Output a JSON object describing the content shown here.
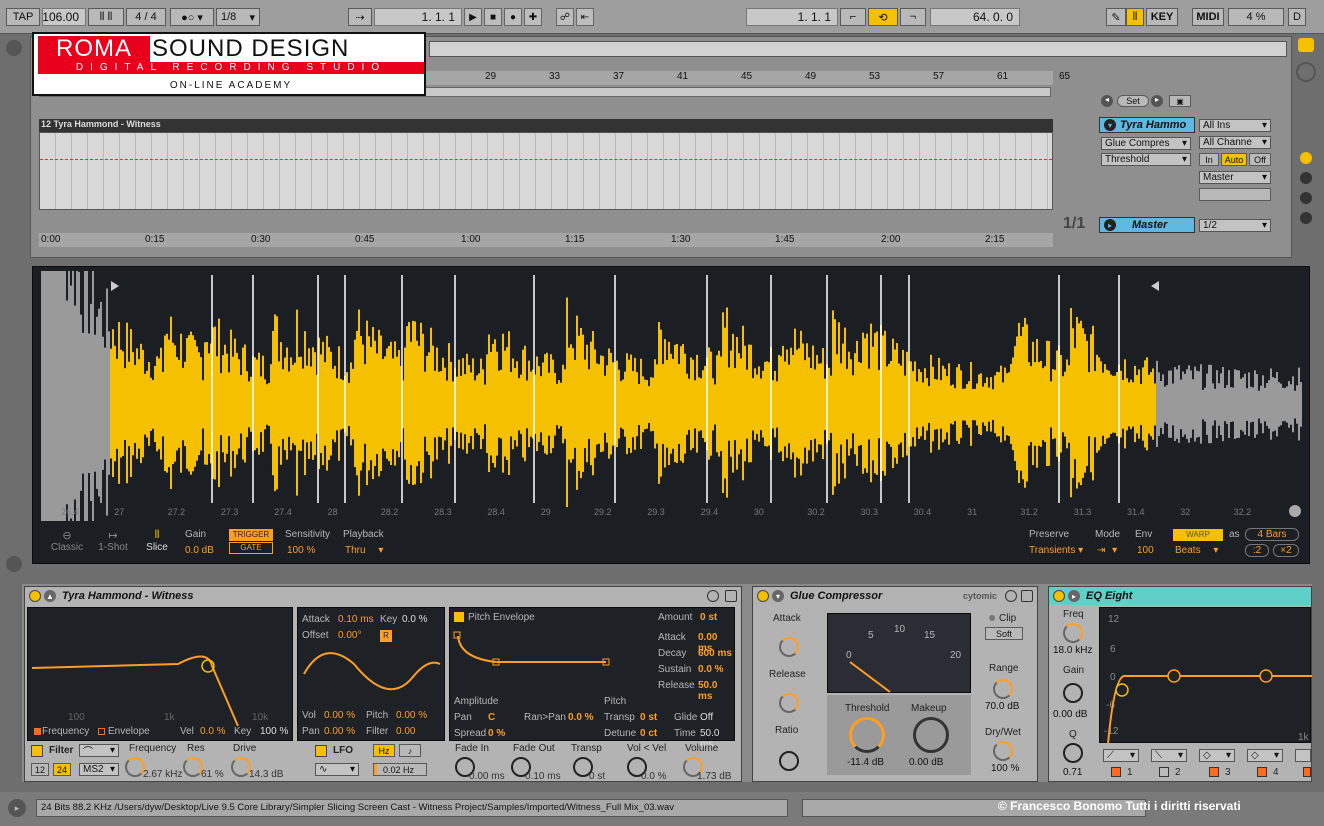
{
  "transport": {
    "tap": "TAP",
    "tempo": "106.00",
    "sig_num": "4",
    "sig_den": "4",
    "quant": "1/8",
    "pos1": "1.   1.   1",
    "pos2": "1.   1.   1",
    "loop_len": "64.   0.   0",
    "key": "KEY",
    "midi": "MIDI",
    "cpu": "4 %",
    "d": "D"
  },
  "logo": {
    "line1a": "ROMA",
    "line1b": "SOUND DESIGN",
    "line2": "DIGITAL RECORDING STUDIO",
    "line3": "ON-LINE ACADEMY"
  },
  "arrangement": {
    "bar_ticks": [
      "29",
      "33",
      "37",
      "41",
      "45",
      "49",
      "53",
      "57",
      "61",
      "65"
    ],
    "track_name": "12 Tyra Hammond - Witness",
    "time_ticks": [
      "0:00",
      "0:15",
      "0:30",
      "0:45",
      "1:00",
      "1:15",
      "1:30",
      "1:45",
      "2:00",
      "2:15"
    ],
    "set_label": "Set",
    "page": "1/1",
    "track_title": "Tyra Hammo",
    "device": "Glue Compres",
    "param": "Threshold",
    "input": "All Ins",
    "channel": "All Channe",
    "mon_in": "In",
    "mon_auto": "Auto",
    "mon_off": "Off",
    "output": "Master",
    "master_label": "Master",
    "master_out": "1/2"
  },
  "sample": {
    "beat_ticks": [
      "26.4",
      "27",
      "27.2",
      "27.3",
      "27.4",
      "28",
      "28.2",
      "28.3",
      "28.4",
      "29",
      "29.2",
      "29.3",
      "29.4",
      "30",
      "30.2",
      "30.3",
      "30.4",
      "31",
      "31.2",
      "31.3",
      "31.4",
      "32",
      "32.2"
    ],
    "modes": [
      "Classic",
      "1-Shot",
      "Slice"
    ],
    "gain_label": "Gain",
    "gain": "0.0 dB",
    "trigger": "TRIGGER",
    "gate": "GATE",
    "sensitivity_label": "Sensitivity",
    "sensitivity": "100 %",
    "playback_label": "Playback",
    "playback": "Thru",
    "preserve_label": "Preserve",
    "preserve": "Transients",
    "mode_label": "Mode",
    "mode": "⇥",
    "env_label": "Env",
    "env": "100",
    "warp": "WARP",
    "as": "as",
    "bars": "4 Bars",
    "half": ":2",
    "double": "×2",
    "beats": "Beats"
  },
  "simpler": {
    "title": "Tyra Hammond - Witness",
    "axis": [
      "100",
      "1k",
      "10k"
    ],
    "legend_freq": "Frequency",
    "legend_env": "Envelope",
    "vel_label": "Vel",
    "vel": "0.0 %",
    "key_label": "Key",
    "key": "100 %",
    "filter": "Filter",
    "f12": "12",
    "f24": "24",
    "ms2": "MS2",
    "freq_label": "Frequency",
    "freq": "2.67 kHz",
    "res_label": "Res",
    "res": "61 %",
    "drive_label": "Drive",
    "drive": "14.3 dB",
    "lfo_attack_label": "Attack",
    "lfo_attack": "0.10 ms",
    "lfo_key_label": "Key",
    "lfo_key": "0.0 %",
    "offset_label": "Offset",
    "offset": "0.00°",
    "r": "R",
    "vol_label": "Vol",
    "vol": "0.00 %",
    "pitch_label": "Pitch",
    "pitch": "0.00 %",
    "pan_label": "Pan",
    "pan": "0.00 %",
    "filter_label": "Filter",
    "filter_val": "0.00",
    "lfo": "LFO",
    "hz": "Hz",
    "note": "♪",
    "rate": "0.02 Hz",
    "pitch_env": "Pitch Envelope",
    "amount_label": "Amount",
    "amount": "0 st",
    "attack_label": "Attack",
    "attack": "0.00 ms",
    "decay_label": "Decay",
    "decay": "600 ms",
    "sustain_label": "Sustain",
    "sustain": "0.0 %",
    "release_label": "Release",
    "release": "50.0 ms",
    "amplitude": "Amplitude",
    "pitch_sec": "Pitch",
    "pan2_label": "Pan",
    "pan2": "C",
    "ranpan_label": "Ran>Pan",
    "ranpan": "0.0 %",
    "transp_label": "Transp",
    "transp": "0 st",
    "glide_label": "Glide",
    "glide": "Off",
    "spread_label": "Spread",
    "spread": "0 %",
    "detune_label": "Detune",
    "detune": "0 ct",
    "time_label": "Time",
    "time": "50.0 ms",
    "fadein_label": "Fade In",
    "fadein": "0.00 ms",
    "fadeout_label": "Fade Out",
    "fadeout": "0.10 ms",
    "transp2_label": "Transp",
    "transp2": "0 st",
    "volvel_label": "Vol < Vel",
    "volvel": "0.0 %",
    "volume_label": "Volume",
    "volume": "1.73 dB"
  },
  "glue": {
    "title": "Glue Compressor",
    "brand": "cytomic",
    "attack_label": "Attack",
    "attack_ticks": [
      ".3",
      "1",
      "3",
      ".1",
      "10",
      ".01",
      "30"
    ],
    "release_label": "Release",
    "release_ticks": [
      ".4",
      ".6",
      ".2",
      "1.2",
      "A",
      ".1"
    ],
    "ratio_label": "Ratio",
    "ratio_ticks": [
      "2",
      "4",
      "10"
    ],
    "meter_ticks": [
      "0",
      "5",
      "10",
      "15",
      "20"
    ],
    "clip": "Clip",
    "soft": "Soft",
    "threshold_label": "Threshold",
    "threshold": "-11.4 dB",
    "makeup_label": "Makeup",
    "makeup": "0.00 dB",
    "range_label": "Range",
    "range": "70.0 dB",
    "drywet_label": "Dry/Wet",
    "drywet": "100 %"
  },
  "eq": {
    "title": "EQ Eight",
    "freq_label": "Freq",
    "freq": "18.0 kHz",
    "gain_label": "Gain",
    "gain": "0.00 dB",
    "q_label": "Q",
    "q": "0.71",
    "y_ticks": [
      "12",
      "6",
      "0",
      "-6",
      "-12"
    ],
    "x_tick": "1k",
    "bands": [
      "1",
      "2",
      "3",
      "4"
    ]
  },
  "status": {
    "path": "24 Bits 88.2 KHz /Users/dyw/Desktop/Live 9.5 Core Library/Simpler Slicing Screen Cast - Witness Project/Samples/Imported/Witness_Full Mix_03.wav",
    "copyright": "© Francesco Bonomo Tutti i diritti riservati"
  }
}
